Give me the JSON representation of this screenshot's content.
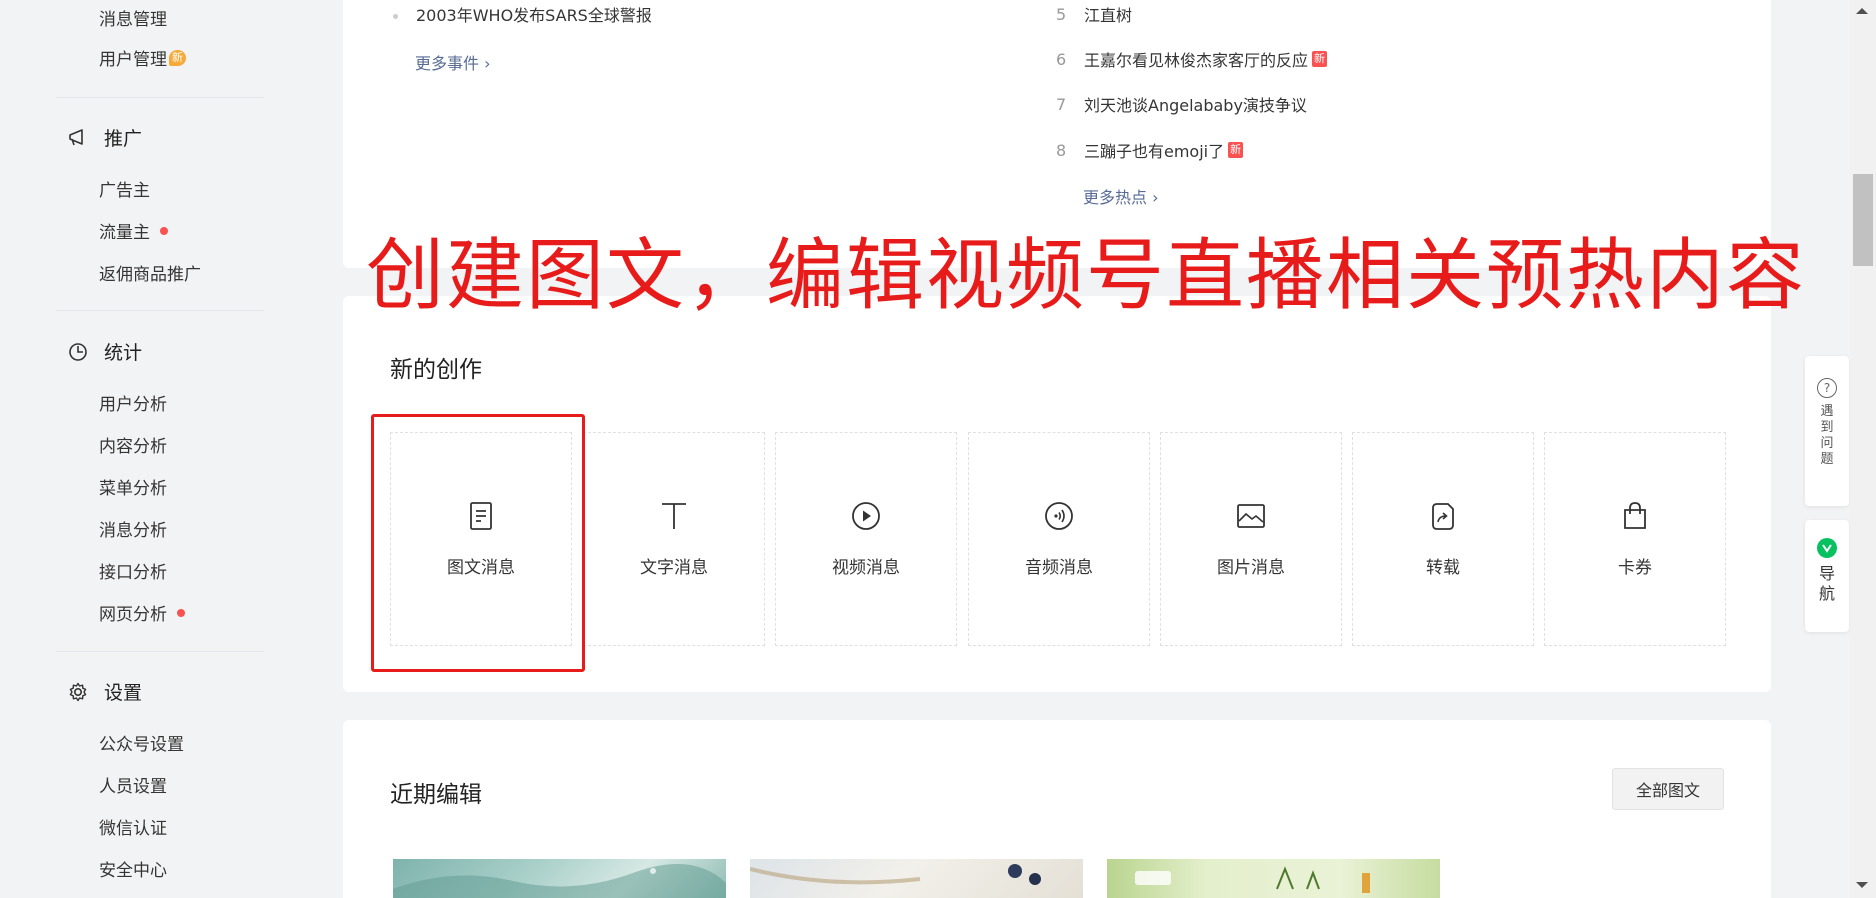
{
  "sidebar": {
    "top_items": [
      {
        "label": "消息管理"
      },
      {
        "label": "用户管理",
        "badge": "新"
      }
    ],
    "promotion": {
      "title": "推广",
      "items": [
        {
          "label": "广告主"
        },
        {
          "label": "流量主"
        },
        {
          "label": "返佣商品推广"
        }
      ]
    },
    "stats": {
      "title": "统计",
      "items": [
        {
          "label": "用户分析"
        },
        {
          "label": "内容分析"
        },
        {
          "label": "菜单分析"
        },
        {
          "label": "消息分析"
        },
        {
          "label": "接口分析"
        },
        {
          "label": "网页分析"
        }
      ]
    },
    "settings": {
      "title": "设置",
      "items": [
        {
          "label": "公众号设置"
        },
        {
          "label": "人员设置"
        },
        {
          "label": "微信认证"
        },
        {
          "label": "安全中心"
        }
      ]
    }
  },
  "events": {
    "item": "2003年WHO发布SARS全球警报",
    "more": "更多事件 ›"
  },
  "hot": {
    "items": [
      {
        "num": "5",
        "text": "江直树"
      },
      {
        "num": "6",
        "text": "王嘉尔看见林俊杰家客厅的反应",
        "badge": "新"
      },
      {
        "num": "7",
        "text": "刘天池谈Angelababy演技争议"
      },
      {
        "num": "8",
        "text": "三蹦子也有emoji了",
        "badge": "新"
      }
    ],
    "more": "更多热点 ›"
  },
  "overlay_caption": "创建图文，编辑视频号直播相关预热内容",
  "create": {
    "title": "新的创作",
    "tiles": [
      {
        "label": "图文消息",
        "icon": "article-icon"
      },
      {
        "label": "文字消息",
        "icon": "text-icon"
      },
      {
        "label": "视频消息",
        "icon": "video-icon"
      },
      {
        "label": "音频消息",
        "icon": "audio-icon"
      },
      {
        "label": "图片消息",
        "icon": "image-icon"
      },
      {
        "label": "转载",
        "icon": "repost-icon"
      },
      {
        "label": "卡券",
        "icon": "coupon-icon"
      }
    ]
  },
  "recent": {
    "title": "近期编辑",
    "all_button": "全部图文"
  },
  "helper": {
    "help_icon": "?",
    "help_text": "遇到问题",
    "nav_text": "导航"
  },
  "colors": {
    "accent_link": "#576b95",
    "overlay_red": "#e81b1b",
    "badge_orange": "#f7a93a",
    "dot_red": "#fa5151",
    "nav_green": "#07c160"
  }
}
